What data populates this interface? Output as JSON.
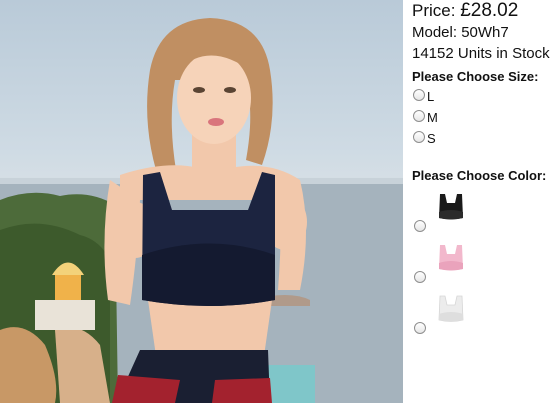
{
  "product": {
    "price_label": "Price:",
    "price_amount": "£28.02",
    "model": "Model: 50Wh7",
    "stock": "14152 Units in Stock"
  },
  "size_section": {
    "title": "Please Choose Size:",
    "options": [
      "L",
      "M",
      "S"
    ]
  },
  "color_section": {
    "title": "Please Choose Color:",
    "options": [
      {
        "icon": "black-sports-bra-swatch",
        "color": "#1a1a1a"
      },
      {
        "icon": "pink-sports-bra-swatch",
        "color": "#f2b8cc"
      },
      {
        "icon": "white-sports-bra-swatch",
        "color": "#ececec"
      }
    ]
  }
}
